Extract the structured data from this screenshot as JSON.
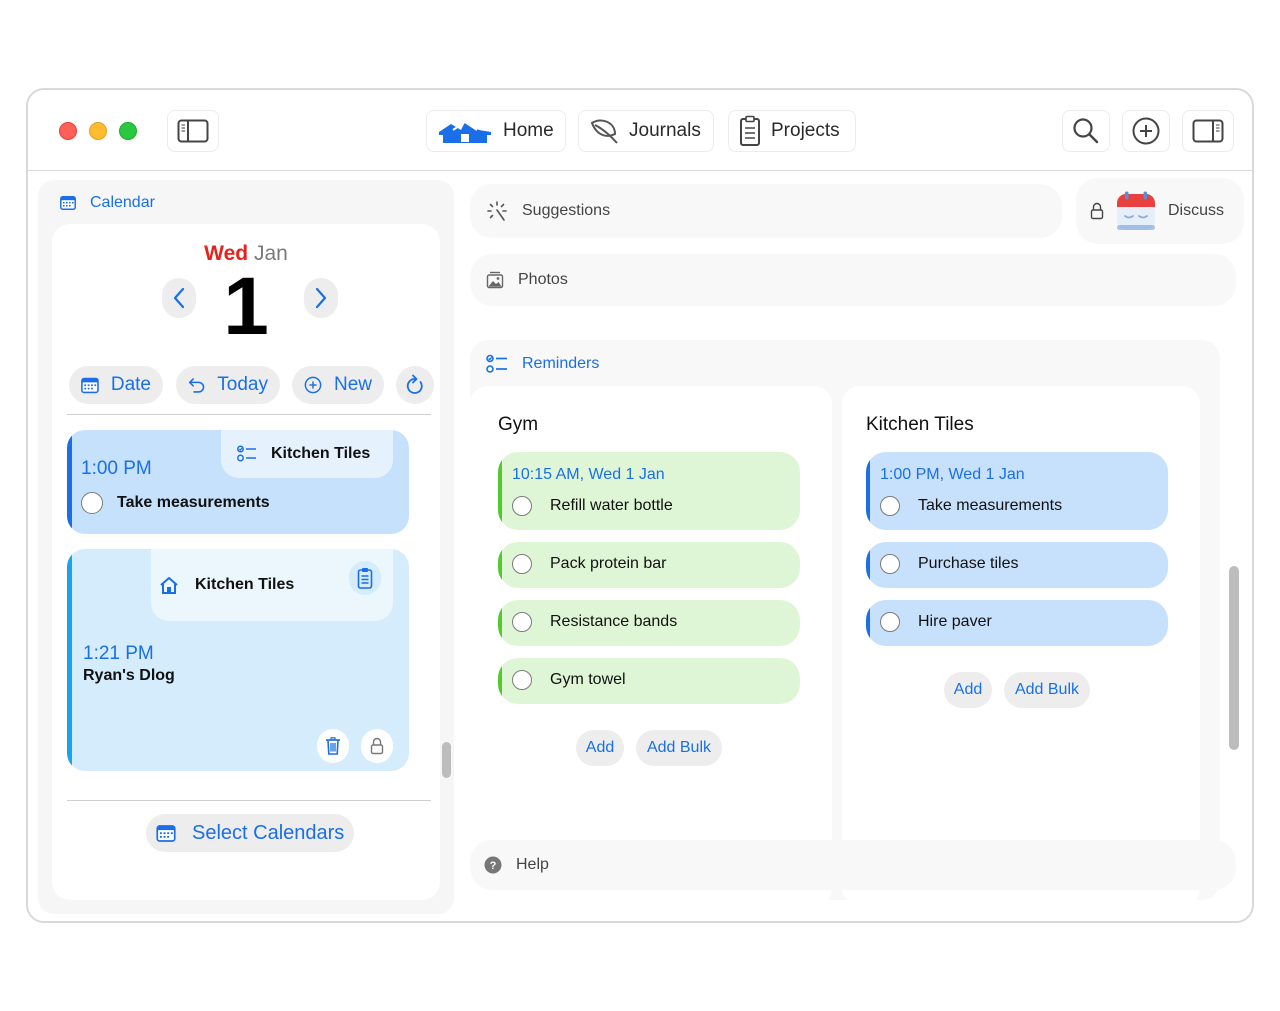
{
  "window": {
    "toolbar": {
      "sidebar_toggle_icon": "sidebar-left-icon",
      "nav": [
        {
          "label": "Home",
          "icon": "houses-icon"
        },
        {
          "label": "Journals",
          "icon": "leaf-icon"
        },
        {
          "label": "Projects",
          "icon": "clipboard-icon"
        }
      ],
      "right_icons": [
        "search-icon",
        "add-circle-icon",
        "sidebar-right-icon"
      ]
    }
  },
  "calendar": {
    "header": "Calendar",
    "weekday": "Wed",
    "month": "Jan",
    "day": "1",
    "buttons": {
      "date": "Date",
      "today": "Today",
      "new": "New"
    },
    "events": [
      {
        "project": "Kitchen Tiles",
        "time": "1:00 PM",
        "title": "Take measurements",
        "type": "reminder"
      },
      {
        "project": "Kitchen Tiles",
        "time": "1:21 PM",
        "title": "Ryan's Dlog",
        "type": "journal"
      }
    ],
    "select_calendars": "Select Calendars"
  },
  "panels": {
    "suggestions": "Suggestions",
    "discuss": "Discuss",
    "photos": "Photos",
    "help": "Help"
  },
  "reminders": {
    "header": "Reminders",
    "lists": [
      {
        "title": "Gym",
        "color": "#4fcb2c",
        "items": [
          {
            "due": "10:15 AM, Wed 1 Jan",
            "title": "Refill water bottle",
            "done": false
          },
          {
            "title": "Pack protein bar",
            "done": false
          },
          {
            "title": "Resistance bands",
            "done": false
          },
          {
            "title": "Gym towel",
            "done": false
          }
        ],
        "add_label": "Add",
        "add_bulk_label": "Add Bulk"
      },
      {
        "title": "Kitchen Tiles",
        "color": "#1a6fe8",
        "items": [
          {
            "due": "1:00 PM, Wed 1 Jan",
            "title": "Take measurements",
            "done": false
          },
          {
            "title": "Purchase tiles",
            "done": false
          },
          {
            "title": "Hire paver",
            "done": false
          }
        ],
        "add_label": "Add",
        "add_bulk_label": "Add Bulk"
      }
    ]
  },
  "colors": {
    "accent": "#1a6fe8",
    "weekday_red": "#e8211b",
    "green_list": "#4fcb2c"
  }
}
